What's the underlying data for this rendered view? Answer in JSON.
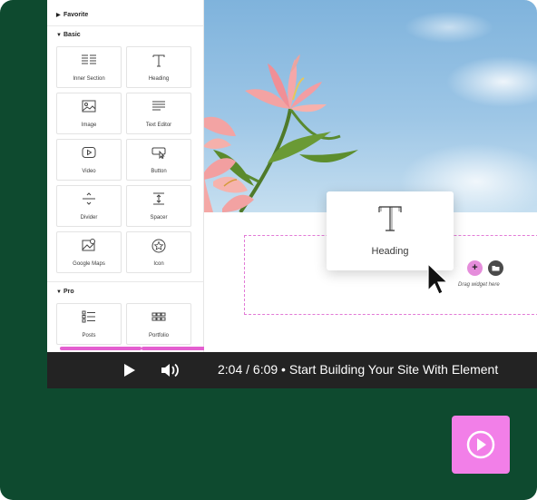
{
  "sidebar": {
    "sections": {
      "favorite": "Favorite",
      "basic": "Basic",
      "pro": "Pro"
    },
    "basic_widgets": [
      {
        "label": "Inner Section",
        "icon": "inner-section-icon"
      },
      {
        "label": "Heading",
        "icon": "heading-icon"
      },
      {
        "label": "Image",
        "icon": "image-icon"
      },
      {
        "label": "Text Editor",
        "icon": "text-editor-icon"
      },
      {
        "label": "Video",
        "icon": "video-icon"
      },
      {
        "label": "Button",
        "icon": "button-icon"
      },
      {
        "label": "Divider",
        "icon": "divider-icon"
      },
      {
        "label": "Spacer",
        "icon": "spacer-icon"
      },
      {
        "label": "Google Maps",
        "icon": "map-icon"
      },
      {
        "label": "Icon",
        "icon": "star-icon"
      }
    ],
    "pro_widgets": [
      {
        "label": "Posts",
        "icon": "posts-icon"
      },
      {
        "label": "Portfolio",
        "icon": "portfolio-icon"
      }
    ]
  },
  "canvas": {
    "dragged_widget_label": "Heading",
    "drop_hint": "Drag widget here",
    "add_button_label": "+"
  },
  "player": {
    "time": "2:04 / 6:09",
    "separator": " • ",
    "title": "Start Building Your Site With Element"
  },
  "colors": {
    "frame_bg": "#0e4a2f",
    "accent_pink": "#f27fe8",
    "player_bg": "#232323"
  }
}
